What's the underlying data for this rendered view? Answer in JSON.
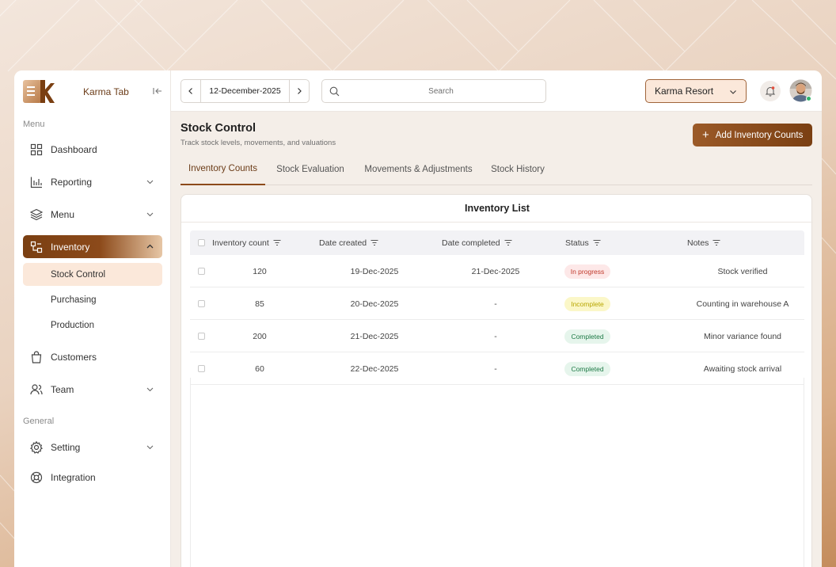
{
  "brand": {
    "name": "Karma Tab"
  },
  "sidebar": {
    "menu_label": "Menu",
    "general_label": "General",
    "items": [
      {
        "label": "Dashboard"
      },
      {
        "label": "Reporting"
      },
      {
        "label": "Menu"
      },
      {
        "label": "Inventory"
      },
      {
        "label": "Customers"
      },
      {
        "label": "Team"
      },
      {
        "label": "Setting"
      },
      {
        "label": "Integration"
      }
    ],
    "inventory_sub": [
      {
        "label": "Stock Control"
      },
      {
        "label": "Purchasing"
      },
      {
        "label": "Production"
      }
    ]
  },
  "topbar": {
    "date": "12-December-2025",
    "search_placeholder": "Search",
    "resort": "Karma Resort"
  },
  "page": {
    "title": "Stock Control",
    "subtitle": "Track stock levels, movements, and valuations",
    "add_button": "Add Inventory Counts",
    "tabs": [
      {
        "label": "Inventory Counts"
      },
      {
        "label": "Stock Evaluation"
      },
      {
        "label": "Movements & Adjustments"
      },
      {
        "label": "Stock History"
      }
    ]
  },
  "table": {
    "title": "Inventory List",
    "columns": [
      "Inventory count",
      "Date created",
      "Date completed",
      "Status",
      "Notes"
    ],
    "rows": [
      {
        "count": "120",
        "created": "19-Dec-2025",
        "completed": "21-Dec-2025",
        "status": "In progress",
        "notes": "Stock verified"
      },
      {
        "count": "85",
        "created": "20-Dec-2025",
        "completed": "-",
        "status": "Incomplete",
        "notes": "Counting in warehouse A"
      },
      {
        "count": "200",
        "created": "21-Dec-2025",
        "completed": "-",
        "status": "Completed",
        "notes": "Minor variance found"
      },
      {
        "count": "60",
        "created": "22-Dec-2025",
        "completed": "-",
        "status": "Completed",
        "notes": "Awaiting stock arrival"
      }
    ]
  },
  "colors": {
    "brand_brown": "#7a3f12",
    "in_progress_bg": "#fde8e8",
    "in_progress_fg": "#c0392b",
    "incomplete_bg": "#fbf7c8",
    "incomplete_fg": "#b8a600",
    "completed_bg": "#e6f5ec",
    "completed_fg": "#1e7a46"
  }
}
